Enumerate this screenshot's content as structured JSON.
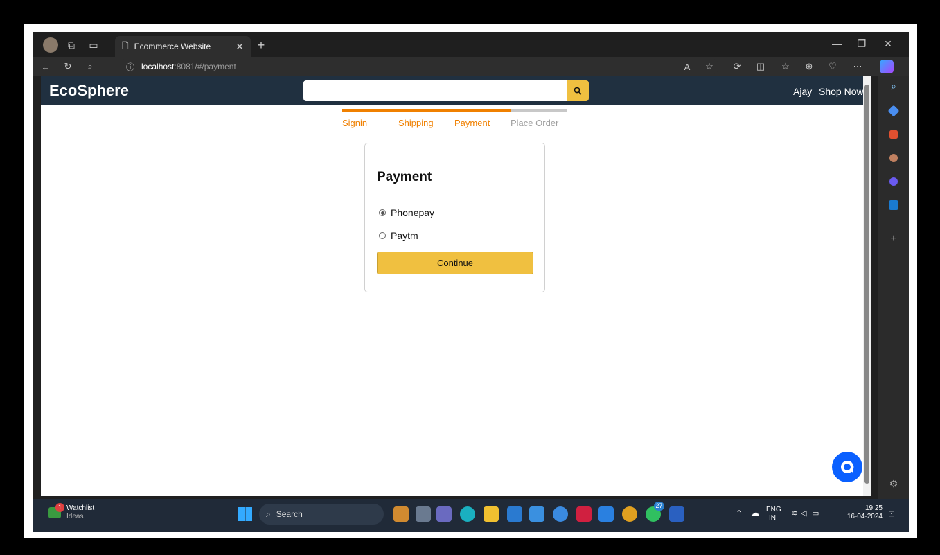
{
  "browser": {
    "tab_title": "Ecommerce Website",
    "url_host": "localhost",
    "url_path": ":8081/#/payment"
  },
  "navbar": {
    "brand": "EcoSphere",
    "search_placeholder": "",
    "user_label": "Ajay",
    "shop_label": "Shop Now"
  },
  "steps": [
    {
      "label": "Signin",
      "active": true
    },
    {
      "label": "Shipping",
      "active": true
    },
    {
      "label": "Payment",
      "active": true
    },
    {
      "label": "Place Order",
      "active": false
    }
  ],
  "payment": {
    "title": "Payment",
    "options": [
      {
        "label": "Phonepay",
        "checked": true
      },
      {
        "label": "Paytm",
        "checked": false
      }
    ],
    "continue_label": "Continue"
  },
  "colors": {
    "navbar_bg": "#203040",
    "accent": "#f0c040",
    "step_active": "#f08000",
    "step_inactive": "#a0a0a0",
    "chat": "#0a60ff"
  },
  "taskbar": {
    "watchlist_title": "Watchlist",
    "watchlist_sub": "Ideas",
    "watchlist_badge": "1",
    "search_label": "Search",
    "whatsapp_badge": "27",
    "lang_top": "ENG",
    "lang_bottom": "IN",
    "time": "19:25",
    "date": "16-04-2024"
  }
}
